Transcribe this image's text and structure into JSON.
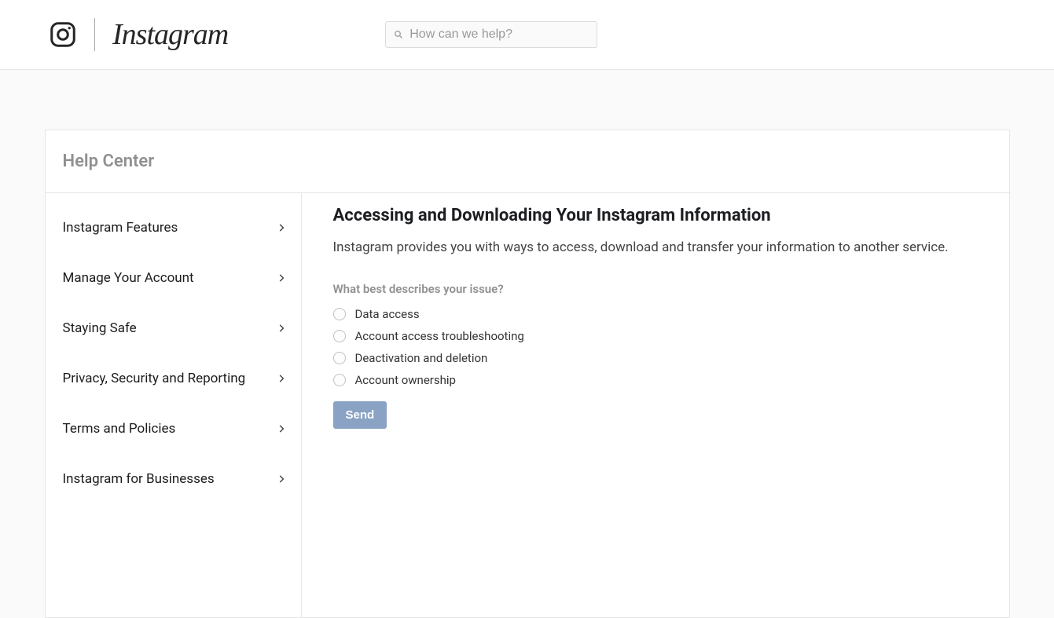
{
  "header": {
    "brand": "Instagram",
    "search_placeholder": "How can we help?"
  },
  "page": {
    "title": "Help Center"
  },
  "sidebar": {
    "items": [
      {
        "label": "Instagram Features"
      },
      {
        "label": "Manage Your Account"
      },
      {
        "label": "Staying Safe"
      },
      {
        "label": "Privacy, Security and Reporting"
      },
      {
        "label": "Terms and Policies"
      },
      {
        "label": "Instagram for Businesses"
      }
    ]
  },
  "content": {
    "heading": "Accessing and Downloading Your Instagram Information",
    "intro": "Instagram provides you with ways to access, download and transfer your information to another service.",
    "form_label": "What best describes your issue?",
    "options": [
      {
        "label": "Data access"
      },
      {
        "label": "Account access troubleshooting"
      },
      {
        "label": "Deactivation and deletion"
      },
      {
        "label": "Account ownership"
      }
    ],
    "send_label": "Send"
  }
}
